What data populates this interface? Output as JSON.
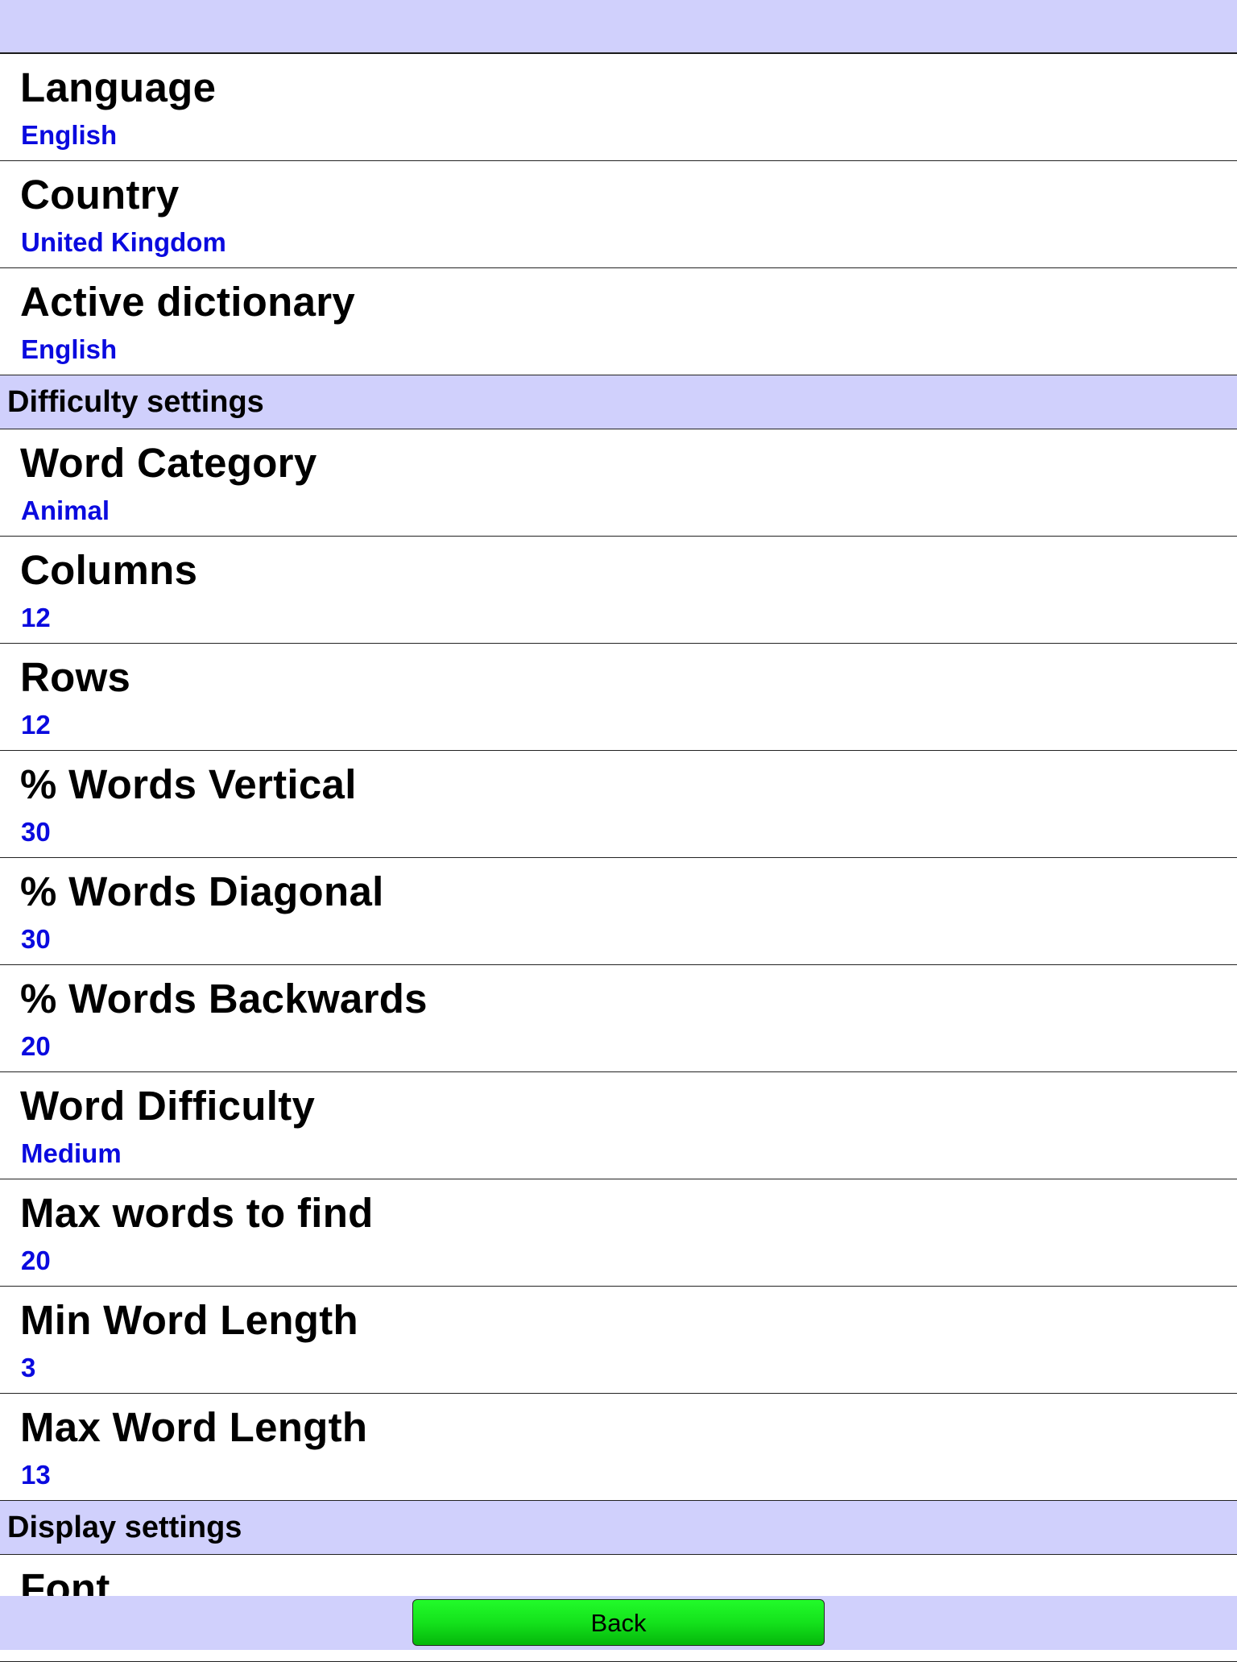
{
  "header": {
    "title": ""
  },
  "general_settings": [
    {
      "label": "Language",
      "value": "English"
    },
    {
      "label": "Country",
      "value": "United Kingdom"
    },
    {
      "label": "Active dictionary",
      "value": "English"
    }
  ],
  "difficulty_section": {
    "title": "Difficulty settings",
    "items": [
      {
        "label": "Word Category",
        "value": "Animal"
      },
      {
        "label": "Columns",
        "value": "12"
      },
      {
        "label": "Rows",
        "value": "12"
      },
      {
        "label": "% Words Vertical",
        "value": "30"
      },
      {
        "label": "% Words Diagonal",
        "value": "30"
      },
      {
        "label": "% Words Backwards",
        "value": "20"
      },
      {
        "label": "Word Difficulty",
        "value": "Medium"
      },
      {
        "label": "Max words to find",
        "value": "20"
      },
      {
        "label": "Min Word Length",
        "value": "3"
      },
      {
        "label": "Max Word Length",
        "value": "13"
      }
    ]
  },
  "display_section": {
    "title": "Display settings",
    "items": [
      {
        "label": "Font",
        "value": ""
      }
    ]
  },
  "footer": {
    "back_label": "Back"
  },
  "colors": {
    "header_bg": "#d0d0fc",
    "value_text": "#0a0adf",
    "back_button": "#14e21c"
  }
}
